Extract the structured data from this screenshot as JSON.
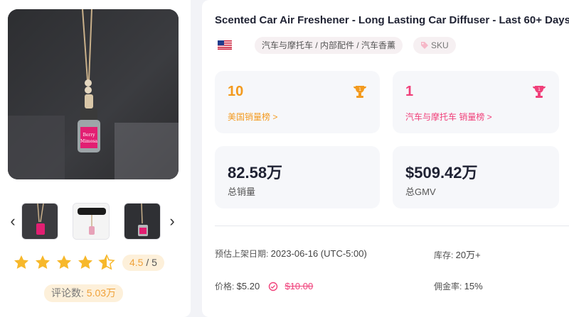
{
  "product": {
    "title": "Scented Car Air Freshener - Long Lasting Car Diffuser - Last 60+ Days",
    "category_path": "汽车与摩托车 / 内部配件 / 汽车香薰",
    "sku_label": "SKU",
    "bottle_label_line1": "Berry",
    "bottle_label_line2": "Mimosa"
  },
  "rating": {
    "score": "4.5",
    "outof": " / 5",
    "stars": 4.5,
    "review_label": "评论数: ",
    "review_count": "5.03万"
  },
  "rank_cards": [
    {
      "rank": "10",
      "label": "美国销量榜 >"
    },
    {
      "rank": "1",
      "label": "汽车与摩托车 销量榜 >"
    }
  ],
  "stat_cards": [
    {
      "value": "82.58万",
      "label": "总销量"
    },
    {
      "value": "$509.42万",
      "label": "总GMV"
    }
  ],
  "details": {
    "listing_label": "预估上架日期: ",
    "listing_value": "2023-06-16 (UTC-5:00)",
    "stock_label": "库存: ",
    "stock_value": "20万+",
    "price_label": "价格: ",
    "price_value": "$5.20",
    "original_price": "$10.00",
    "commission_label": "佣金率: ",
    "commission_value": "15%"
  },
  "icons": {
    "prev": "chevron-left-icon",
    "next": "chevron-right-icon",
    "flag": "us-flag-icon",
    "tag": "tag-icon",
    "trophy": "trophy-icon",
    "history": "price-history-icon"
  },
  "colors": {
    "orange": "#f39a1e",
    "pink": "#f0407a",
    "star": "#f7b82b"
  }
}
